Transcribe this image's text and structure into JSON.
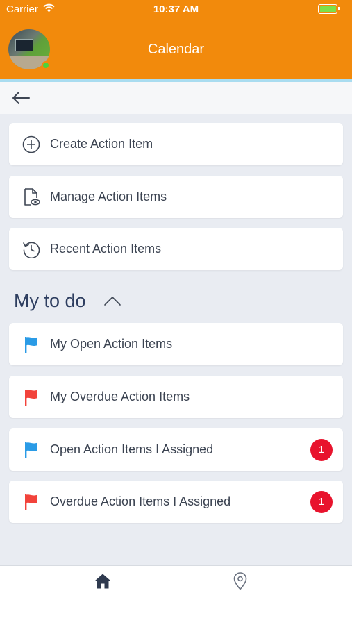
{
  "status_bar": {
    "carrier": "Carrier",
    "time": "10:37 AM",
    "battery_color": "#7ee04a"
  },
  "header": {
    "title": "Calendar",
    "background_color": "#f28a0c",
    "online_status_color": "#4cd33b"
  },
  "nav": {
    "back_icon": "arrow-left-icon"
  },
  "actions": [
    {
      "label": "Create Action Item",
      "icon": "plus-circle-icon"
    },
    {
      "label": "Manage Action Items",
      "icon": "document-eye-icon"
    },
    {
      "label": "Recent Action Items",
      "icon": "history-clock-icon"
    }
  ],
  "todo": {
    "title": "My to do",
    "toggle_icon": "chevron-up-icon",
    "items": [
      {
        "label": "My Open Action Items",
        "icon": "flag-blue-icon",
        "flag_color": "#2a9be6"
      },
      {
        "label": "My Overdue Action Items",
        "icon": "flag-red-icon",
        "flag_color": "#f2433b"
      },
      {
        "label": "Open Action Items I Assigned",
        "icon": "flag-blue-icon",
        "flag_color": "#2a9be6",
        "badge": "1"
      },
      {
        "label": "Overdue Action Items I Assigned",
        "icon": "flag-red-icon",
        "flag_color": "#f2433b",
        "badge": "1"
      }
    ],
    "badge_color": "#e8132d"
  },
  "tab_bar": {
    "tabs": [
      {
        "name": "home",
        "icon": "home-icon"
      },
      {
        "name": "location",
        "icon": "location-pin-icon"
      }
    ]
  }
}
